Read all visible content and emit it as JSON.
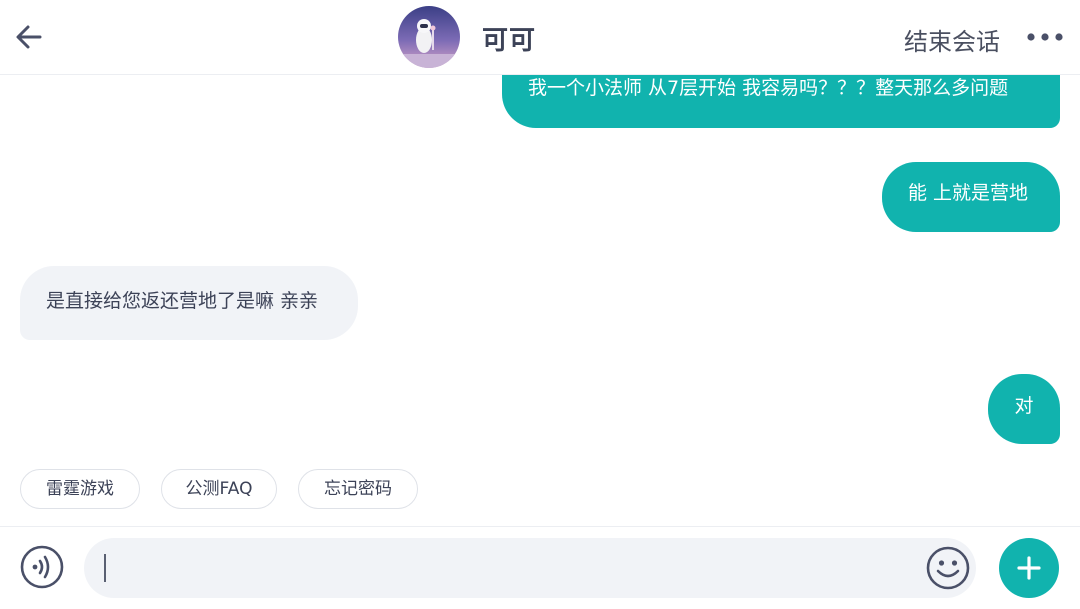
{
  "header": {
    "title": "可可",
    "end_label": "结束会话",
    "back_icon": "arrow-left-icon",
    "more_icon": "more-dots-icon"
  },
  "messages": [
    {
      "side": "out",
      "text": "我一个小法师 从7层开始 我容易吗？？？整天那么多问题"
    },
    {
      "side": "out",
      "text": "能 上就是营地"
    },
    {
      "side": "in",
      "text": "是直接给您返还营地了是嘛 亲亲"
    },
    {
      "side": "out",
      "text": "对"
    }
  ],
  "quick_replies": [
    "雷霆游戏",
    "公测FAQ",
    "忘记密码"
  ],
  "input": {
    "value": "",
    "voice_icon": "voice-icon",
    "emoji_icon": "emoji-icon",
    "add_icon": "plus-icon"
  },
  "colors": {
    "accent": "#11b3ae",
    "incoming_bubble": "#f1f3f7",
    "text": "#3c4257"
  }
}
